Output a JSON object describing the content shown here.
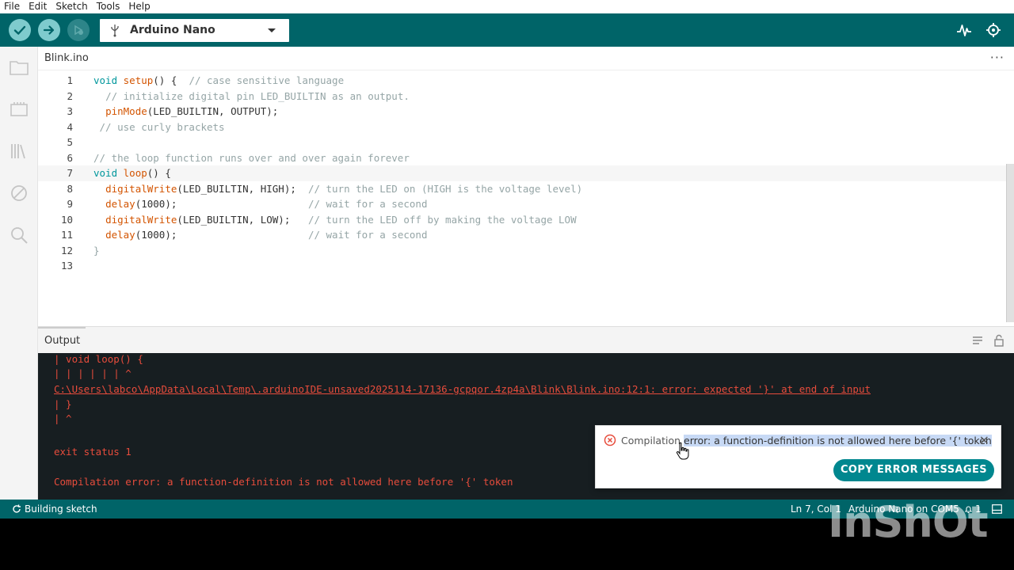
{
  "menu": [
    "File",
    "Edit",
    "Sketch",
    "Tools",
    "Help"
  ],
  "toolbar": {
    "board": "Arduino Nano"
  },
  "colors": {
    "teal": "#006468",
    "keyword": "#00979c",
    "function": "#d35400",
    "comment": "#95a5a6",
    "error": "#e74c3c"
  },
  "editor": {
    "tab": "Blink.ino",
    "more": "···",
    "current_line": 7
  },
  "output": {
    "title": "Output",
    "lines": [
      "| void loop() {",
      "| | | | | | ^",
      "C:\\Users\\labco\\AppData\\Local\\Temp\\.arduinoIDE-unsaved2025114-17136-gcpqor.4zp4a\\Blink\\Blink.ino:12:1: error: expected '}' at end of input",
      "| }",
      "| ^",
      "",
      "exit status 1",
      "",
      "Compilation error: a function-definition is not allowed here before '{' token"
    ]
  },
  "notification": {
    "msg_prefix": "Compilation ",
    "msg_highlight": "error: a function-definition is not allowed here before '{' token",
    "close": "×",
    "button": "COPY ERROR MESSAGES"
  },
  "status": {
    "building": "Building sketch",
    "position": "Ln 7, Col 1",
    "board_port": "Arduino Nano on COM5",
    "notifications": "1"
  },
  "watermark": "InShOt"
}
